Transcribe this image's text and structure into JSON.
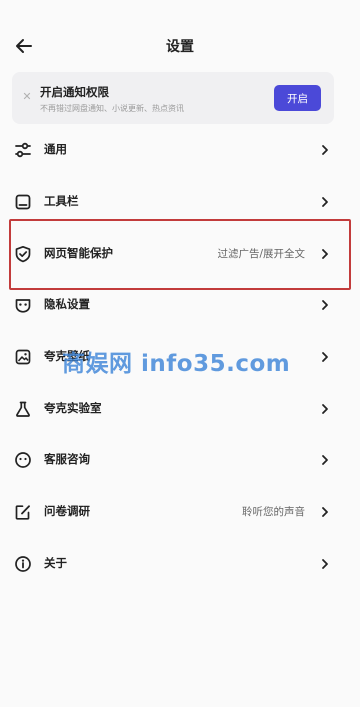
{
  "header": {
    "title": "设置"
  },
  "notice": {
    "title": "开启通知权限",
    "subtitle": "不再错过网盘通知、小说更新、热点资讯",
    "button_label": "开启"
  },
  "items": [
    {
      "label": "通用",
      "value": "",
      "icon": "sliders-icon"
    },
    {
      "label": "工具栏",
      "value": "",
      "icon": "toolbar-icon"
    },
    {
      "label": "网页智能保护",
      "value": "过滤广告/展开全文",
      "icon": "shield-check-icon"
    },
    {
      "label": "隐私设置",
      "value": "",
      "icon": "privacy-mask-icon"
    },
    {
      "label": "夸克壁纸",
      "value": "",
      "icon": "wallpaper-icon"
    },
    {
      "label": "夸克实验室",
      "value": "",
      "icon": "flask-icon"
    },
    {
      "label": "客服咨询",
      "value": "",
      "icon": "customer-service-icon"
    },
    {
      "label": "问卷调研",
      "value": "聆听您的声音",
      "icon": "survey-edit-icon"
    },
    {
      "label": "关于",
      "value": "",
      "icon": "info-icon"
    }
  ],
  "watermark": "商娱网 info35.com",
  "colors": {
    "accent": "#4b49d8",
    "highlight_border": "#c23b3b",
    "watermark": "#3f86d9"
  }
}
